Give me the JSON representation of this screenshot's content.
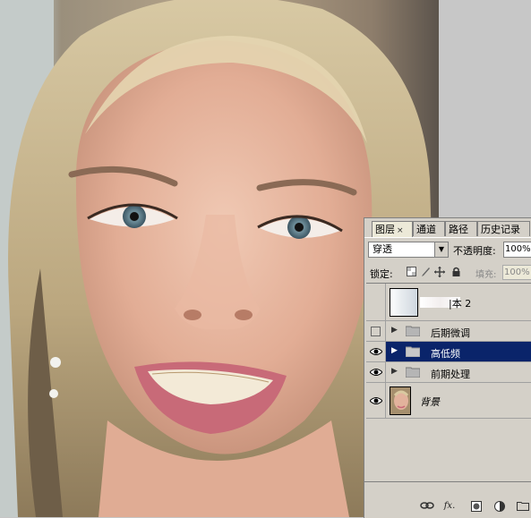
{
  "panel": {
    "tabs": [
      {
        "label": "图层",
        "close": "×"
      },
      {
        "label": "通道"
      },
      {
        "label": "路径"
      },
      {
        "label": "历史记录"
      }
    ],
    "blend_mode": "穿透",
    "opacity_label": "不透明度:",
    "opacity_value": "100%",
    "lock_label": "锁定:",
    "fill_label": "填充:",
    "fill_value": "100%",
    "layers": [
      {
        "name": "|本 2",
        "type": "layer",
        "visible": false,
        "selected": false
      },
      {
        "name": "后期微调",
        "type": "group",
        "visible": false,
        "selected": false
      },
      {
        "name": "高低频",
        "type": "group",
        "visible": true,
        "selected": true
      },
      {
        "name": "前期处理",
        "type": "group",
        "visible": true,
        "selected": false
      },
      {
        "name": "背景",
        "type": "layer",
        "visible": true,
        "selected": false
      }
    ],
    "bottom_icons": [
      "link-icon",
      "fx-icon",
      "mask-icon",
      "adjustment-icon",
      "new-group-icon"
    ]
  },
  "colors": {
    "selected_row": "#0a246a",
    "panel_bg": "#d4d0c8"
  }
}
